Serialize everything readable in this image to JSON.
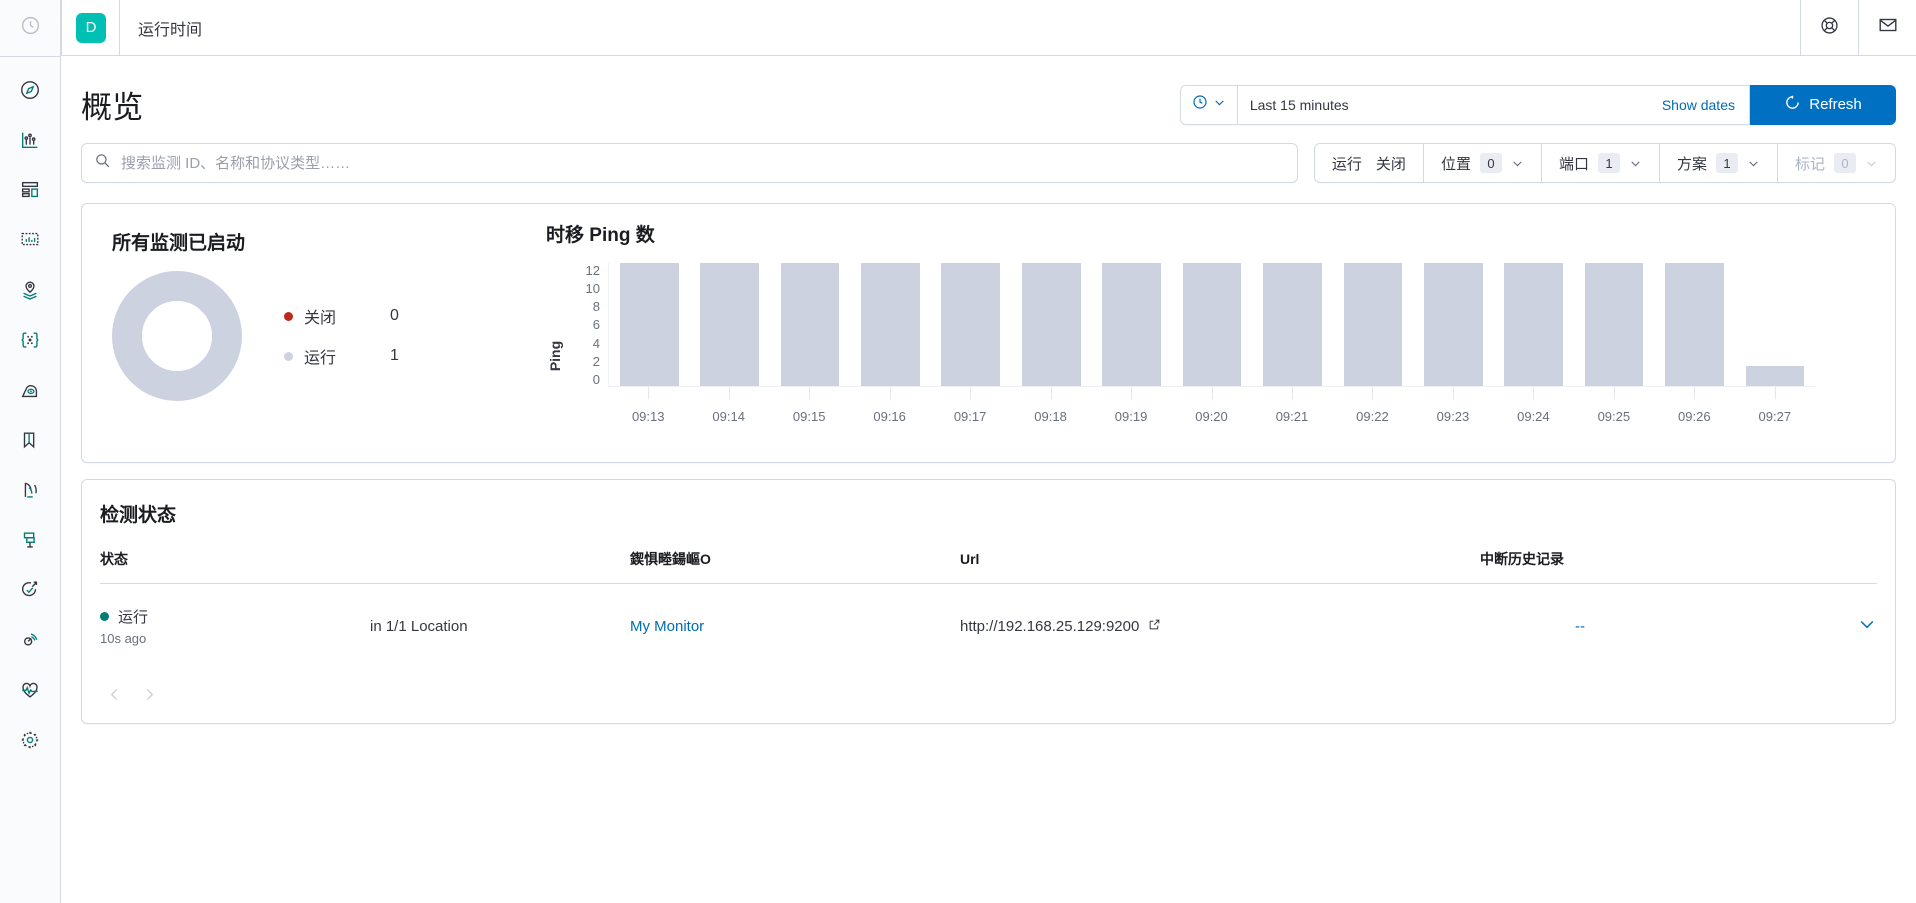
{
  "topbar": {
    "logo_text": "D",
    "breadcrumb": "运行时间",
    "help_icon": "life-ring-icon",
    "mail_icon": "mail-icon"
  },
  "sidebar": {
    "recent_icon": "clock-icon",
    "items": [
      {
        "icon": "compass-icon",
        "name": "discover"
      },
      {
        "icon": "analytics-icon",
        "name": "analytics"
      },
      {
        "icon": "dashboard-icon",
        "name": "dashboard"
      },
      {
        "icon": "canvas-icon",
        "name": "canvas"
      },
      {
        "icon": "maps-icon",
        "name": "maps"
      },
      {
        "icon": "machine-learning-icon",
        "name": "machine-learning"
      },
      {
        "icon": "user-experience-icon",
        "name": "user-experience"
      },
      {
        "icon": "logs-icon",
        "name": "logs"
      },
      {
        "icon": "metrics-icon",
        "name": "metrics"
      },
      {
        "icon": "uptime-icon",
        "name": "uptime"
      },
      {
        "icon": "apm-icon",
        "name": "apm"
      },
      {
        "icon": "dev-tools-icon",
        "name": "dev-tools"
      },
      {
        "icon": "heartbeat-icon",
        "name": "heartbeat"
      },
      {
        "icon": "gear-icon",
        "name": "management"
      }
    ]
  },
  "page": {
    "title": "概览"
  },
  "timepicker": {
    "clock_icon": "clock-icon",
    "chevron_icon": "chevron-down-icon",
    "value": "Last 15 minutes",
    "show_dates": "Show dates",
    "refresh_label": "Refresh",
    "refresh_icon": "refresh-icon"
  },
  "search": {
    "icon": "search-icon",
    "value": "",
    "placeholder": "搜索监测 ID、名称和协议类型……"
  },
  "filters": [
    {
      "name": "status",
      "labels": [
        "运行",
        "关闭"
      ],
      "type": "split"
    },
    {
      "name": "location",
      "label": "位置",
      "count": "0",
      "disabled": false
    },
    {
      "name": "port",
      "label": "端口",
      "count": "1",
      "disabled": false
    },
    {
      "name": "scheme",
      "label": "方案",
      "count": "1",
      "disabled": false
    },
    {
      "name": "tags",
      "label": "标记",
      "count": "0",
      "disabled": true
    }
  ],
  "donut": {
    "title": "所有监测已启动",
    "colors": {
      "down": "#bd271e",
      "up": "#ccd2e0"
    },
    "legend": [
      {
        "label": "关闭",
        "value": "0",
        "color": "#bd271e"
      },
      {
        "label": "运行",
        "value": "1",
        "color": "#ccd2e0"
      }
    ]
  },
  "chart_data": {
    "type": "bar",
    "title": "时移 Ping 数",
    "xlabel": "",
    "ylabel": "Ping",
    "ylim": [
      0,
      12
    ],
    "yticks": [
      "12",
      "10",
      "8",
      "6",
      "4",
      "2",
      "0"
    ],
    "grid": false,
    "legend": "none",
    "bar_color": "#ccd2e0",
    "categories": [
      "09:13",
      "09:14",
      "09:15",
      "09:16",
      "09:17",
      "09:18",
      "09:19",
      "09:20",
      "09:21",
      "09:22",
      "09:23",
      "09:24",
      "09:25",
      "09:26",
      "09:27"
    ],
    "values": [
      12,
      12,
      12,
      12,
      12,
      12,
      12,
      12,
      12,
      12,
      12,
      12,
      12,
      12,
      2
    ]
  },
  "table": {
    "title": "检测状态",
    "columns": [
      "状态",
      "",
      "鍥惧畻鍚嶇О",
      "Url",
      "中断历史记录",
      ""
    ],
    "rows": [
      {
        "status": "运行",
        "status_ago": "10s ago",
        "status_color": "#017d73",
        "location": "in 1/1 Location",
        "monitor_name": "My Monitor",
        "url": "http://192.168.25.129:9200",
        "url_icon": "external-link-icon",
        "downtime_history": "--",
        "expand_icon": "chevron-down-icon"
      }
    ],
    "pager": {
      "prev_icon": "chevron-left-icon",
      "next_icon": "chevron-right-icon"
    }
  }
}
